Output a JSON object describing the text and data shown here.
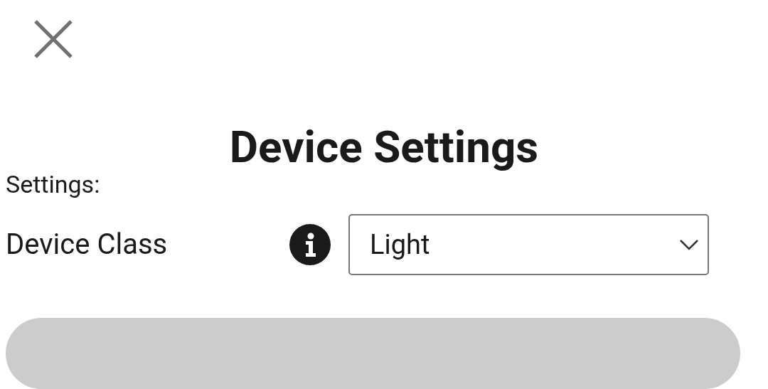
{
  "dialog": {
    "title": "Device Settings"
  },
  "section_label": "Settings:",
  "fields": [
    {
      "label": "Device Class",
      "value": "Light"
    }
  ]
}
